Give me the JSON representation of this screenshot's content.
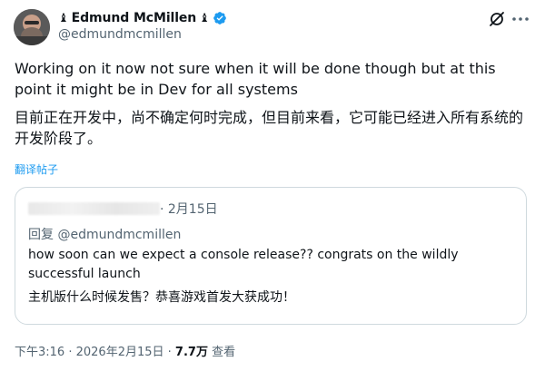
{
  "author": {
    "display_name": "Edmund McMillen",
    "handle": "@edmundmcmillen",
    "name_prefix_glyph": "♝",
    "name_suffix_glyph": "♝",
    "verified": true,
    "verified_color": "#1d9bf0"
  },
  "header_icons": [
    "grok-icon",
    "more-icon"
  ],
  "post": {
    "text_en": "Working on it now not sure when it will be done though but at this point it might be in Dev for all systems",
    "text_zh": "目前正在开发中，尚不确定何时完成，但目前来看，它可能已经进入所有系统的开发阶段了。",
    "translate_label": "翻译帖子"
  },
  "quote": {
    "date": "· 2月15日",
    "reply_prefix": "回复",
    "reply_handle": "@edmundmcmillen",
    "text_en": "how soon can we expect a console release?? congrats on the wildly successful launch",
    "text_zh": "主机版什么时候发售？恭喜游戏首发大获成功！"
  },
  "meta": {
    "time": "下午3:16",
    "date": "2026年2月15日",
    "views_count": "7.7万",
    "views_label": "查看"
  },
  "colors": {
    "text": "#0f1419",
    "secondary": "#536471",
    "link": "#1d9bf0",
    "border": "#cfd9de"
  }
}
